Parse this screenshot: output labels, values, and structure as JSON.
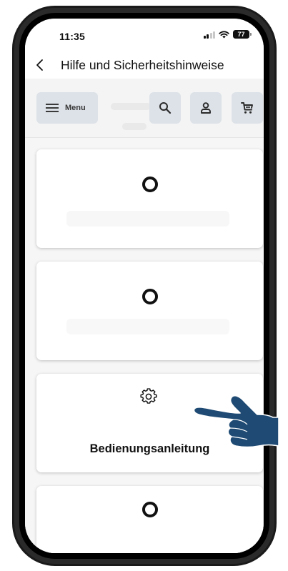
{
  "status_bar": {
    "time": "11:35",
    "battery": "77"
  },
  "nav": {
    "back_icon": "chevron-left-icon",
    "title": "Hilfe und Sicherheitshinweise"
  },
  "header": {
    "menu_label": "Menu",
    "menu_icon": "hamburger-icon",
    "search_icon": "search-icon",
    "account_icon": "user-icon",
    "cart_icon": "cart-icon"
  },
  "cards": [
    {
      "icon": "ring-icon",
      "label": ""
    },
    {
      "icon": "ring-icon",
      "label": ""
    },
    {
      "icon": "gear-icon",
      "label": "Bedienungsanleitung"
    },
    {
      "icon": "ring-icon",
      "label": ""
    }
  ],
  "colors": {
    "button_background": "#dde2e8",
    "pointer_hand": "#1e4a73",
    "phone_frame": "#1a1a1a"
  },
  "pointer": {
    "icon": "pointing-hand-icon",
    "target": "Bedienungsanleitung"
  }
}
